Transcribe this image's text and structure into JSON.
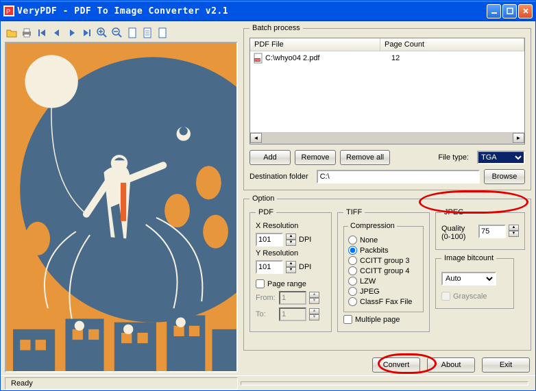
{
  "window": {
    "title": "VeryPDF - PDF To Image Converter v2.1"
  },
  "toolbar_icons": [
    "open",
    "print",
    "first",
    "prev",
    "next",
    "last",
    "zoom-in",
    "zoom-out",
    "page-new",
    "page-copy",
    "page-blank"
  ],
  "batch": {
    "legend": "Batch process",
    "col_file": "PDF File",
    "col_count": "Page Count",
    "rows": [
      {
        "file": "C:\\whyo04 2.pdf",
        "count": "12"
      }
    ],
    "add": "Add",
    "remove": "Remove",
    "remove_all": "Remove all",
    "filetype_label": "File type:",
    "filetype_value": "TGA",
    "dest_label": "Destination folder",
    "dest_value": "C:\\",
    "browse": "Browse"
  },
  "option": {
    "legend": "Option",
    "pdf": {
      "legend": "PDF",
      "xres_label": "X Resolution",
      "xres_value": "101",
      "yres_label": "Y Resolution",
      "yres_value": "101",
      "dpi": "DPI",
      "page_range": "Page range",
      "from_label": "From:",
      "from_value": "1",
      "to_label": "To:",
      "to_value": "1"
    },
    "tiff": {
      "legend": "TIFF",
      "compression_legend": "Compression",
      "opts": [
        "None",
        "Packbits",
        "CCITT group 3",
        "CCITT group 4",
        "LZW",
        "JPEG",
        "ClassF Fax File"
      ],
      "selected": "Packbits",
      "multiple_page": "Multiple page"
    },
    "jpeg": {
      "legend": "JPEG",
      "quality_label": "Quality  (0-100)",
      "quality_value": "75",
      "bitcount_legend": "Image bitcount",
      "bitcount_value": "Auto",
      "grayscale": "Grayscale"
    }
  },
  "buttons": {
    "convert": "Convert",
    "about": "About",
    "exit": "Exit"
  },
  "status": {
    "ready": "Ready"
  }
}
